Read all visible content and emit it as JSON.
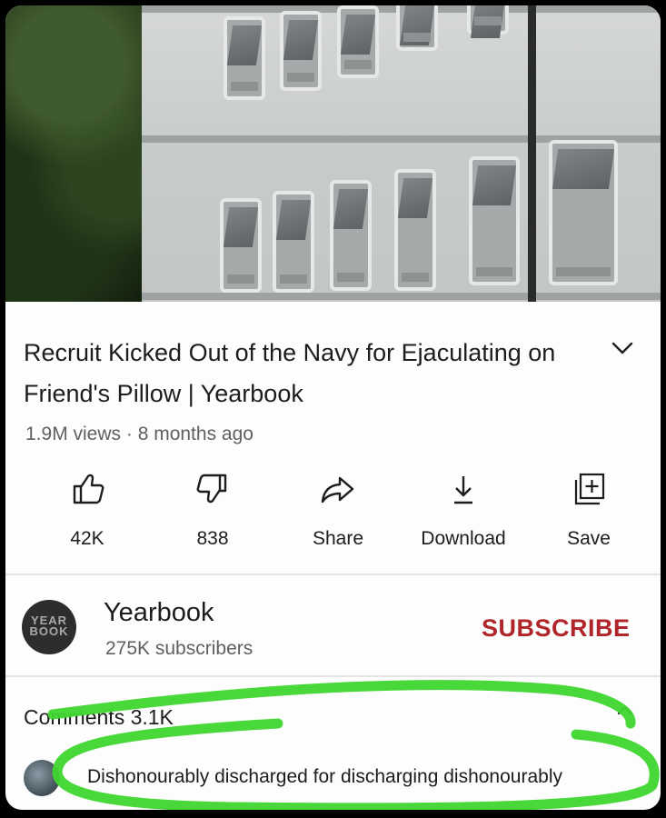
{
  "video": {
    "title": "Recruit Kicked Out of the Navy for Ejaculating on Friend's Pillow | Yearbook",
    "meta": "1.9M views · 8 months ago",
    "expand_icon": "chevron-down-icon"
  },
  "actions": [
    {
      "icon": "thumbs-up-icon",
      "label": "42K"
    },
    {
      "icon": "thumbs-down-icon",
      "label": "838"
    },
    {
      "icon": "share-icon",
      "label": "Share"
    },
    {
      "icon": "download-icon",
      "label": "Download"
    },
    {
      "icon": "save-to-playlist-icon",
      "label": "Save"
    }
  ],
  "channel": {
    "avatar_text": "YEAR BOOK",
    "name": "Yearbook",
    "subscribers": "275K subscribers",
    "subscribe_label": "SUBSCRIBE",
    "subscribe_color": "#b0262b"
  },
  "comments": {
    "heading": "Comments 3.1K",
    "collapse_icon": "chevron-up-icon",
    "top_comment": "Dishonourably discharged for discharging dishonourably",
    "highlight_color": "#3fd62f"
  }
}
